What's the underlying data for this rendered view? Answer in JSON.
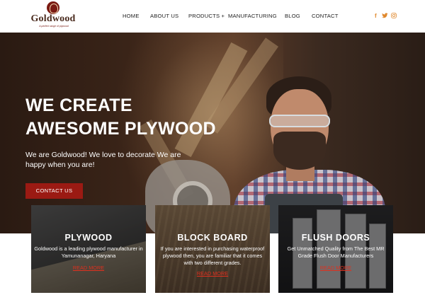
{
  "brand": {
    "name": "Goldwood",
    "tagline": "A perfect range of plywood",
    "colors": {
      "accent": "#9b1a13",
      "social": "#e0892e",
      "link": "#e0301e"
    }
  },
  "nav": {
    "items": [
      {
        "label": "HOME"
      },
      {
        "label": "ABOUT US"
      },
      {
        "label": "PRODUCTS +"
      },
      {
        "label": "MANUFACTURING"
      },
      {
        "label": "BLOG"
      },
      {
        "label": "CONTACT"
      }
    ],
    "social": [
      {
        "icon": "facebook-icon",
        "glyph": "f"
      },
      {
        "icon": "twitter-icon",
        "glyph": "🐦"
      },
      {
        "icon": "instagram-icon",
        "glyph": "◎"
      }
    ]
  },
  "hero": {
    "title_line1": "WE CREATE",
    "title_line2": "AWESOME PLYWOOD",
    "text": "We are Goldwood! We love to decorate We are happy when you are!",
    "cta_label": "CONTACT US"
  },
  "cards": [
    {
      "title": "PLYWOOD",
      "text": "Goldwood is a leading plywood manufacturer in Yamunanagar, Haryana",
      "link": "READ MORE"
    },
    {
      "title": "BLOCK BOARD",
      "text": "If you are interested in purchasing waterproof plywood then, you are familiar that it comes with two different grades.",
      "link": "READ MORE"
    },
    {
      "title": "FLUSH DOORS",
      "text": "Get Unmatched Quality from The Best MR Grade Flush Door Manufacturers",
      "link": "READ MORE"
    }
  ]
}
